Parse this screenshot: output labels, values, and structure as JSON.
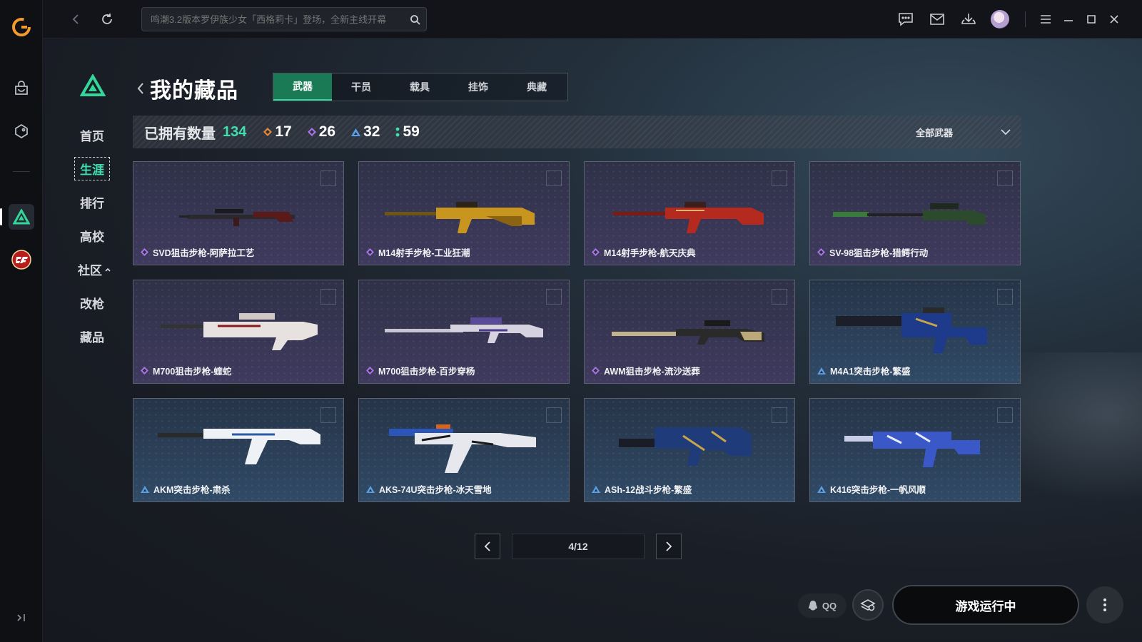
{
  "topbar": {
    "search_placeholder": "鸣潮3.2版本罗伊族少女「西格莉卡」登场，全新主线开幕"
  },
  "sidebar": {
    "items": [
      {
        "label": "首页"
      },
      {
        "label": "生涯"
      },
      {
        "label": "排行"
      },
      {
        "label": "高校"
      },
      {
        "label": "社区"
      },
      {
        "label": "改枪"
      },
      {
        "label": "藏品"
      }
    ],
    "active": "生涯"
  },
  "page": {
    "title": "我的藏品",
    "tabs": [
      {
        "label": "武器",
        "active": true
      },
      {
        "label": "干员",
        "active": false
      },
      {
        "label": "载具",
        "active": false
      },
      {
        "label": "挂饰",
        "active": false
      },
      {
        "label": "典藏",
        "active": false
      }
    ]
  },
  "stats": {
    "owned_label": "已拥有数量",
    "owned_total": "134",
    "counts": [
      {
        "value": "17",
        "color": "#e58a3c"
      },
      {
        "value": "26",
        "color": "#a873e8"
      },
      {
        "value": "32",
        "color": "#5aa0e6"
      },
      {
        "value": "59",
        "color": "#3fe0b0"
      }
    ],
    "filter_label": "全部武器"
  },
  "items": [
    {
      "name": "SVD狙击步枪-阿萨拉工艺",
      "rarity": "purple"
    },
    {
      "name": "M14射手步枪-工业狂潮",
      "rarity": "purple"
    },
    {
      "name": "M14射手步枪-航天庆典",
      "rarity": "purple"
    },
    {
      "name": "SV-98狙击步枪-猎鳄行动",
      "rarity": "purple"
    },
    {
      "name": "M700狙击步枪-蝰蛇",
      "rarity": "purple"
    },
    {
      "name": "M700狙击步枪-百步穿杨",
      "rarity": "purple"
    },
    {
      "name": "AWM狙击步枪-流沙送葬",
      "rarity": "purple"
    },
    {
      "name": "M4A1突击步枪-繁盛",
      "rarity": "blue"
    },
    {
      "name": "AKM突击步枪-肃杀",
      "rarity": "blue"
    },
    {
      "name": "AKS-74U突击步枪-冰天雪地",
      "rarity": "blue"
    },
    {
      "name": "ASh-12战斗步枪-繁盛",
      "rarity": "blue"
    },
    {
      "name": "K416突击步枪-一帆风顺",
      "rarity": "blue"
    }
  ],
  "pagination": {
    "label": "4/12",
    "current": 4,
    "total": 12
  },
  "bottom": {
    "qq_label": "QQ",
    "launch_label": "游戏运行中"
  },
  "colors": {
    "accent": "#3fe0b0",
    "tab_active_bg": "#1a7a56",
    "purple_rarity": "#a873e8",
    "blue_rarity": "#5aa0e6"
  },
  "icons": {
    "app_logo": "g-logo-icon",
    "rail": [
      "bag-icon",
      "tag-icon",
      "delta-force-icon",
      "crossfire-icon",
      "collapse-icon"
    ],
    "topbar": [
      "back-icon",
      "refresh-icon",
      "search-icon",
      "chat-icon",
      "mail-icon",
      "download-icon",
      "menu-icon",
      "minimize-icon",
      "maximize-icon",
      "close-icon"
    ]
  }
}
